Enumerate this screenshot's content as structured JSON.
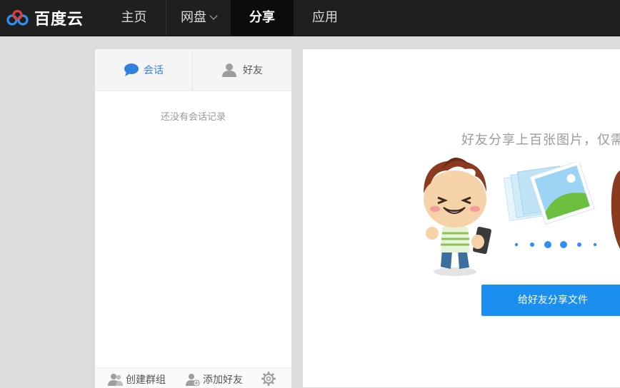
{
  "brand": {
    "name": "百度云"
  },
  "nav": {
    "items": [
      {
        "label": "主页"
      },
      {
        "label": "网盘"
      },
      {
        "label": "分享"
      },
      {
        "label": "应用"
      }
    ]
  },
  "conversations": {
    "tabs": [
      {
        "label": "会话"
      },
      {
        "label": "好友"
      }
    ],
    "empty_text": "还没有会话记录",
    "footer": {
      "create_group": "创建群组",
      "add_friend": "添加好友"
    }
  },
  "main": {
    "headline": "好友分享上百张图片，仅需",
    "share_button": "给好友分享文件"
  },
  "colors": {
    "topbar": "#1f1f1f",
    "accent": "#1a8ff0",
    "tab_active": "#3b7ed9",
    "notification": "#e8322f"
  }
}
